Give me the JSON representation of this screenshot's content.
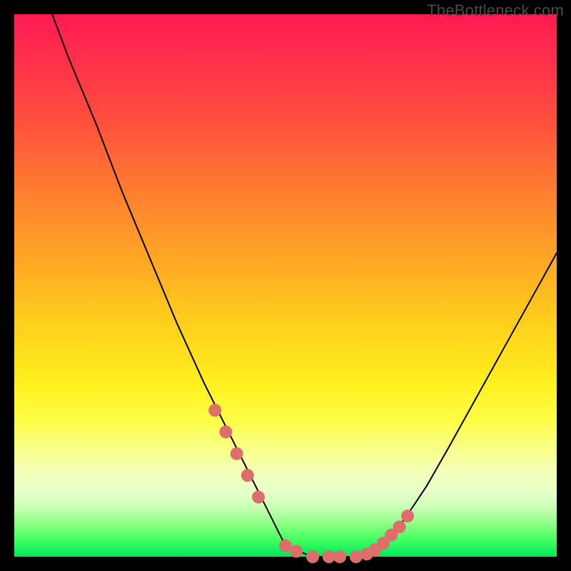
{
  "watermark": "TheBottleneck.com",
  "colors": {
    "page_bg": "#000000",
    "curve": "#000000",
    "markers": "#de6e6c",
    "gradient_stops": [
      "#ff1a52",
      "#ff7432",
      "#ffd21c",
      "#fdfe47",
      "#00e65a"
    ]
  },
  "chart_data": {
    "type": "line",
    "title": "",
    "xlabel": "",
    "ylabel": "",
    "xlim": [
      0,
      100
    ],
    "ylim": [
      0,
      100
    ],
    "grid": false,
    "legend": false,
    "annotations": [],
    "series": [
      {
        "name": "curve",
        "x": [
          7,
          10,
          15,
          20,
          25,
          30,
          35,
          40,
          45,
          48.5,
          50,
          55,
          58,
          60,
          63,
          65,
          68,
          72,
          76,
          80,
          85,
          90,
          95,
          100
        ],
        "values": [
          100,
          92,
          80,
          67,
          55,
          43,
          32,
          22,
          12,
          5,
          2,
          0,
          0,
          0,
          0,
          0.5,
          2,
          7,
          13,
          20,
          29,
          38,
          47,
          56
        ]
      }
    ],
    "markers": {
      "name": "highlighted-points",
      "x": [
        37,
        39,
        41,
        43,
        45,
        50,
        52,
        55,
        58,
        60,
        63,
        65,
        66.5,
        68,
        69.5,
        71,
        72.5
      ],
      "values": [
        27,
        23,
        19,
        15,
        11,
        2,
        1,
        0,
        0,
        0,
        0,
        0.5,
        1.3,
        2.5,
        4,
        5.5,
        7.5
      ]
    }
  }
}
